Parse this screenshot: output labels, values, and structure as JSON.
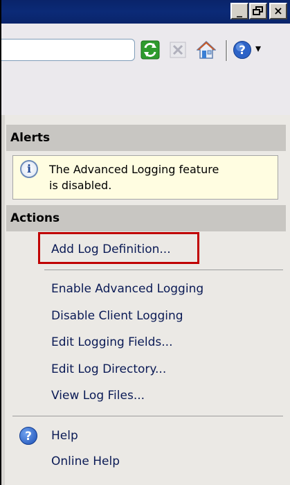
{
  "window": {
    "minimize_glyph": "_",
    "restore_glyph": "🗗",
    "close_glyph": "×"
  },
  "toolbar": {
    "help_dropdown_glyph": "▾"
  },
  "alerts": {
    "header": "Alerts",
    "message_line1": "The Advanced Logging feature",
    "message_line2": "is disabled."
  },
  "actions": {
    "header": "Actions",
    "items": [
      {
        "label": "Add Log Definition..."
      },
      {
        "label": "Enable Advanced Logging"
      },
      {
        "label": "Disable Client Logging"
      },
      {
        "label": "Edit Logging Fields..."
      },
      {
        "label": "Edit Log Directory..."
      },
      {
        "label": "View Log Files..."
      }
    ],
    "help_label": "Help",
    "online_help_label": "Online Help"
  },
  "colors": {
    "title_bar": "#0a246a",
    "highlight_border": "#c00000",
    "link_text": "#0a1a55"
  }
}
